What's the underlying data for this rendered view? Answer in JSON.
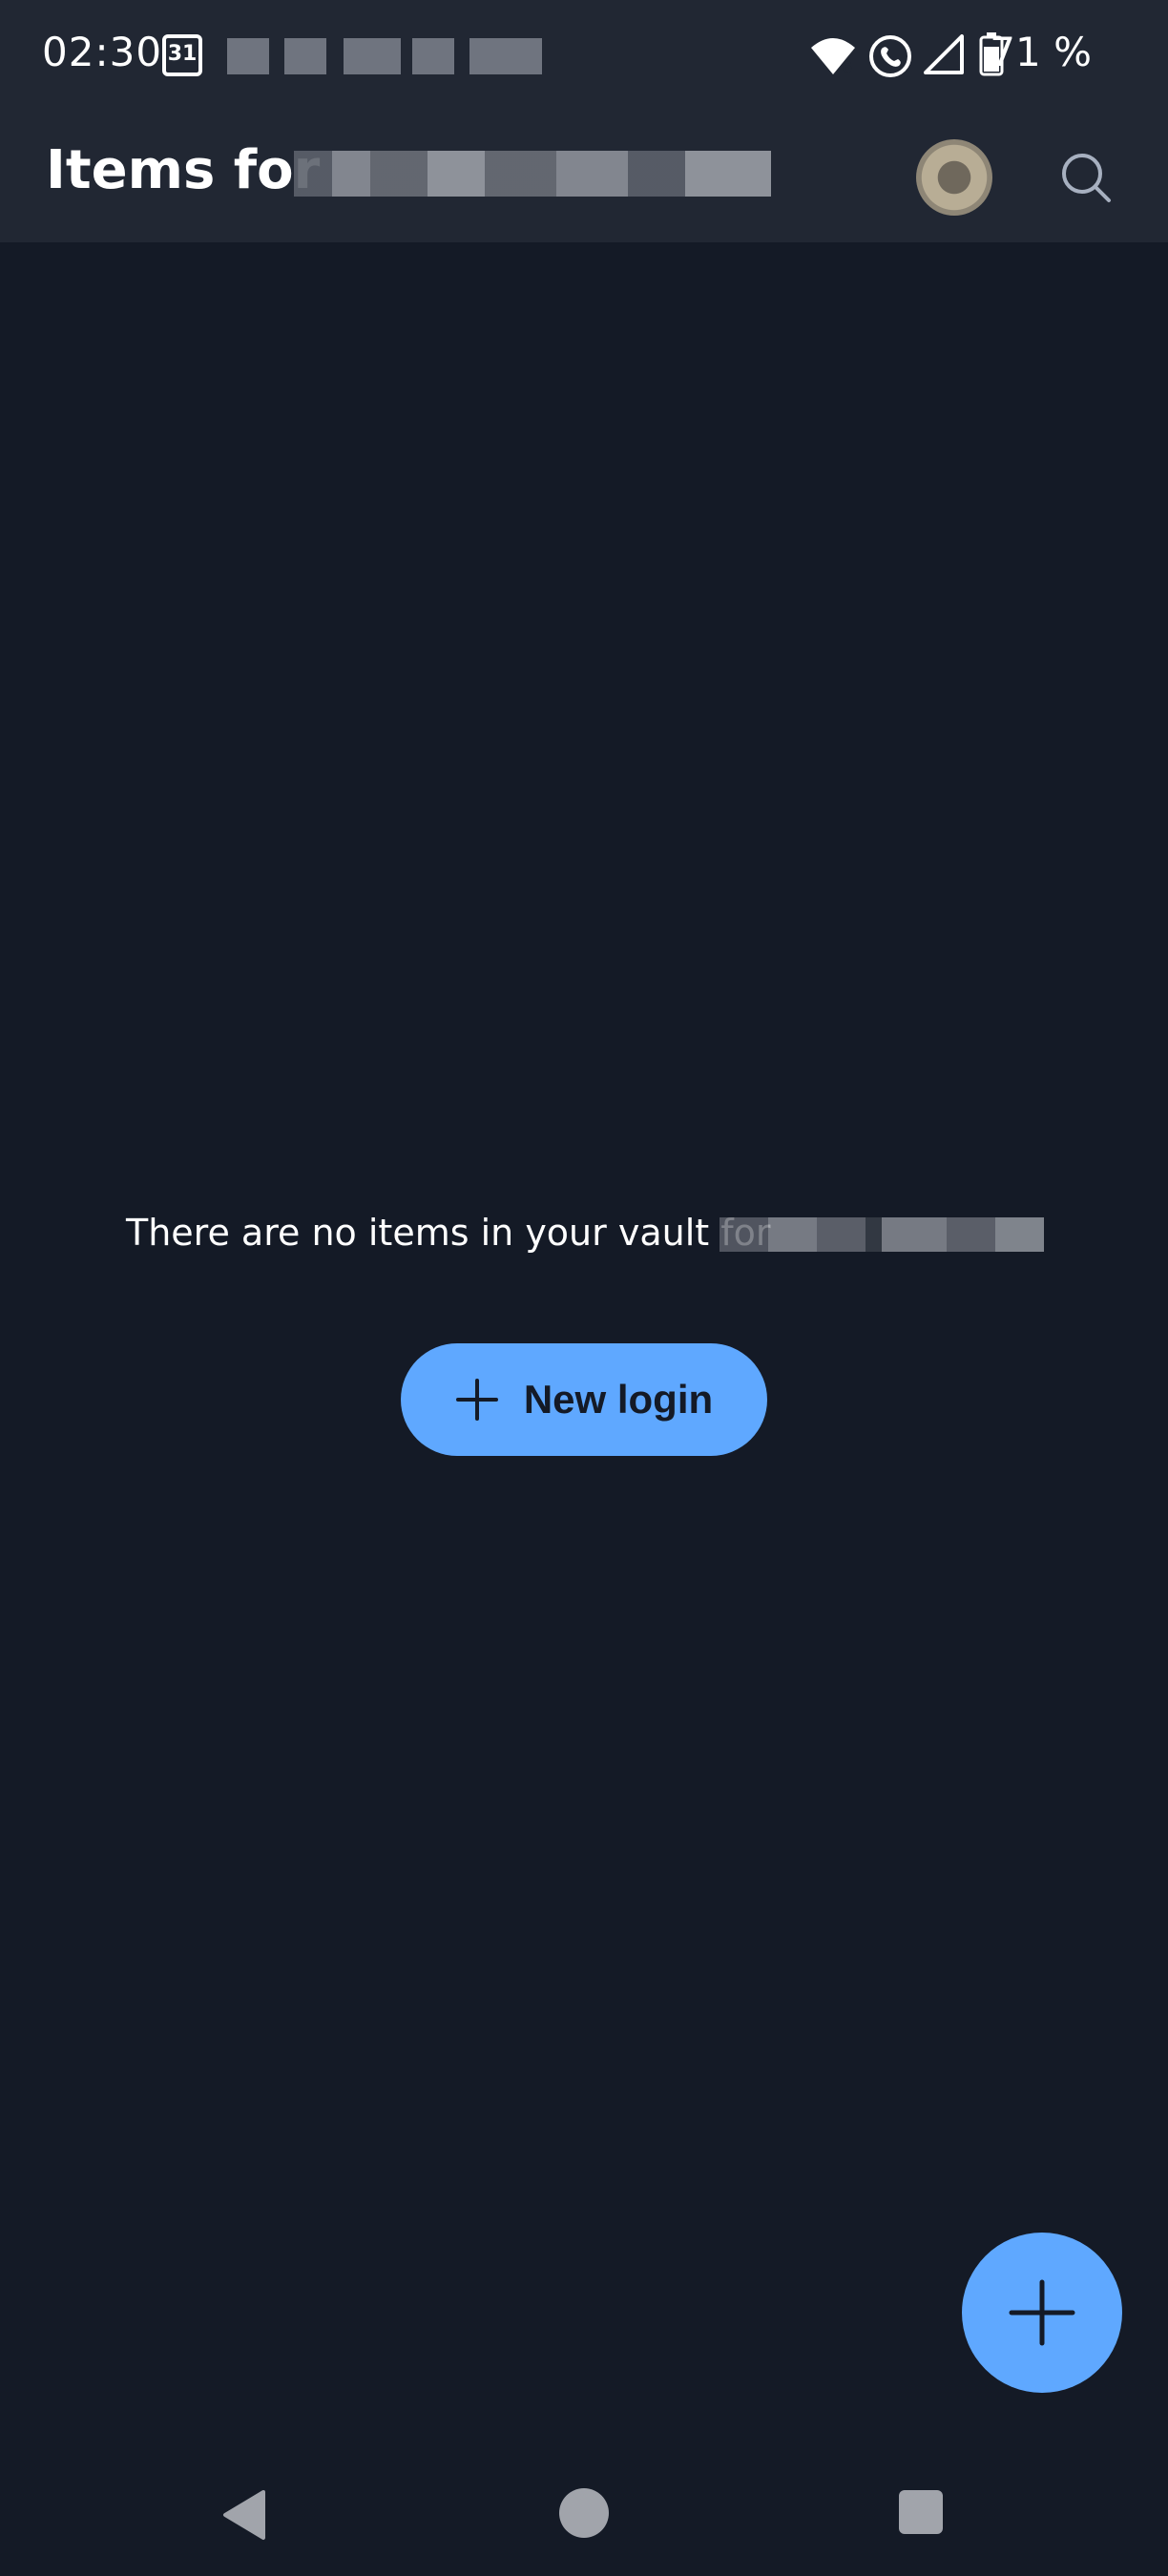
{
  "status_bar": {
    "time": "02:30",
    "calendar_day": "31",
    "battery": "71 %"
  },
  "app_bar": {
    "title": "Items for"
  },
  "empty_state": {
    "message": "There are no items in your vault for",
    "new_login_label": "New login"
  },
  "colors": {
    "background": "#141a26",
    "bar": "#212733",
    "accent": "#5fa8ff"
  },
  "icons": {
    "search": "search-icon",
    "plus": "plus-icon",
    "back": "nav-back-icon",
    "home": "nav-home-icon",
    "recents": "nav-recents-icon"
  }
}
